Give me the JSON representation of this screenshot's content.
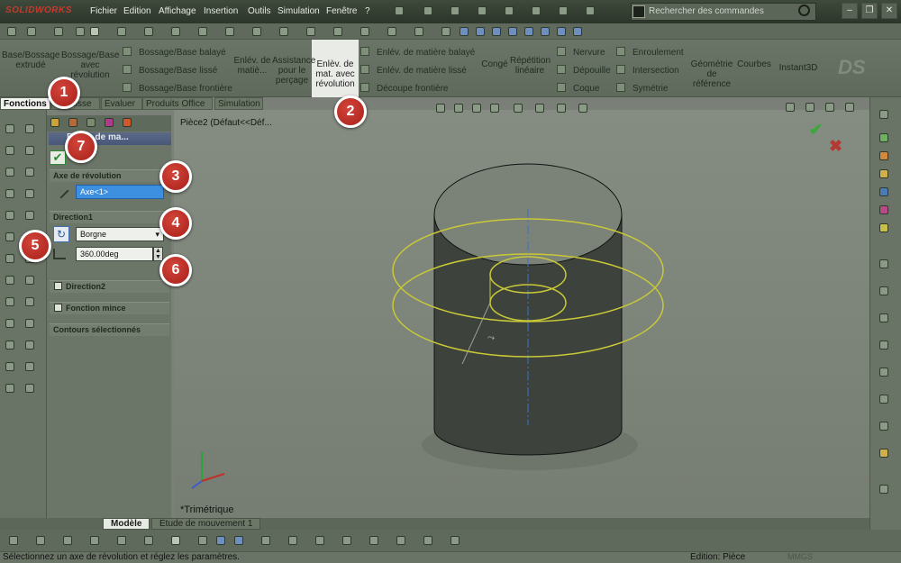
{
  "app": {
    "logo": "SOLIDWORKS"
  },
  "menu": [
    "Fichier",
    "Edition",
    "Affichage",
    "Insertion",
    "Outils",
    "Simulation",
    "Fenêtre",
    "?"
  ],
  "search": {
    "placeholder": "Rechercher des commandes"
  },
  "ribbon": {
    "big": [
      {
        "name": "base-bossage-extrude",
        "label": "Base/Bossage extrudé"
      },
      {
        "name": "bossage-base-revolution",
        "label": "Bossage/Base avec révolution"
      },
      {
        "name": "enlev-matiere",
        "label": "Enlév. de matiè..."
      },
      {
        "name": "assistance-percage",
        "label": "Assistance pour le perçage"
      },
      {
        "name": "enlev-revolution",
        "label": "Enlèv. de mat. avec révolution"
      },
      {
        "name": "conge",
        "label": "Congé"
      },
      {
        "name": "repetition-lineaire",
        "label": "Répétition linéaire"
      },
      {
        "name": "geometrie-reference",
        "label": "Géométrie de référence"
      },
      {
        "name": "courbes",
        "label": "Courbes"
      },
      {
        "name": "instant3d",
        "label": "Instant3D"
      }
    ],
    "small": [
      {
        "name": "bossage-balaye",
        "label": "Bossage/Base balayé"
      },
      {
        "name": "bossage-lisse",
        "label": "Bossage/Base lissé"
      },
      {
        "name": "bossage-frontiere",
        "label": "Bossage/Base frontière"
      },
      {
        "name": "enlev-balaye",
        "label": "Enlév. de matière balayé"
      },
      {
        "name": "enlev-lisse",
        "label": "Enlév. de matière lissé"
      },
      {
        "name": "decoupe-frontiere",
        "label": "Découpe frontière"
      },
      {
        "name": "nervure",
        "label": "Nervure"
      },
      {
        "name": "depouille",
        "label": "Dépouille"
      },
      {
        "name": "coque",
        "label": "Coque"
      },
      {
        "name": "enroulement",
        "label": "Enroulement"
      },
      {
        "name": "intersection",
        "label": "Intersection"
      },
      {
        "name": "symetrie",
        "label": "Symétrie"
      }
    ]
  },
  "tabs": [
    "Fonctions",
    "Esquisse",
    "Evaluer",
    "Produits Office",
    "Simulation"
  ],
  "pm": {
    "title": "Enlév. de ma...",
    "axis_section": "Axe de révolution",
    "axis_value": "Axe<1>",
    "direction1": "Direction1",
    "end_condition": "Borgne",
    "angle": "360.00deg",
    "direction2": "Direction2",
    "thin": "Fonction mince",
    "contours": "Contours sélectionnés"
  },
  "graphics": {
    "path": "Pièce2  (Défaut<<Déf...",
    "view": "*Trimétrique"
  },
  "bottom_tabs": [
    "Modèle",
    "Etude de mouvement 1"
  ],
  "status": {
    "message": "Sélectionnez un axe de révolution et réglez les paramètres.",
    "edit": "Edition: Pièce",
    "units": "MMGS"
  },
  "callouts": [
    "1",
    "2",
    "3",
    "4",
    "5",
    "6",
    "7"
  ],
  "colors": {
    "accent_red": "#c0302a",
    "selection_blue": "#3d8fe0",
    "sketch_yellow": "#c9c937",
    "cylinder": "#3d433c"
  }
}
